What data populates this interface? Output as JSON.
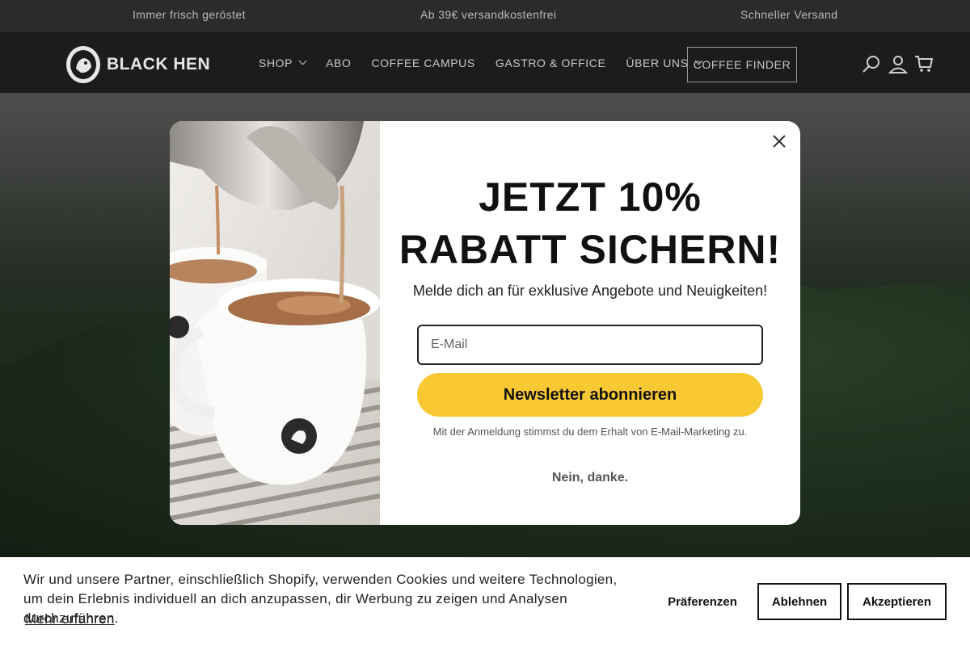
{
  "announcement": {
    "items": [
      "Immer frisch geröstet",
      "Ab 39€ versandkostenfrei",
      "Schneller Versand"
    ]
  },
  "header": {
    "logo_text": "BLACK HEN",
    "nav": [
      "SHOP",
      "ABO",
      "COFFEE CAMPUS",
      "GASTRO & OFFICE",
      "ÜBER UNS"
    ],
    "finder_label": "COFFEE FINDER",
    "icons": [
      "search-icon",
      "account-icon",
      "cart-icon"
    ]
  },
  "popup": {
    "headline_line1": "JETZT 10%",
    "headline_line2": "RABATT SICHERN!",
    "subtitle": "Melde dich an für exklusive Angebote und Neuigkeiten!",
    "email_placeholder": "E-Mail",
    "subscribe_label": "Newsletter abonnieren",
    "legal": "Mit der Anmeldung stimmst du dem Erhalt von E-Mail-Marketing zu.",
    "decline_label": "Nein, danke.",
    "accent_color": "#f9c934"
  },
  "cookie": {
    "text": "Wir und unsere Partner, einschließlich Shopify, verwenden Cookies und weitere Technologien, um dein Erlebnis individuell an dich anzupassen, dir Werbung zu zeigen und Analysen durchzuführen.",
    "link": "Mehr erfahren",
    "preferences": "Präferenzen",
    "decline": "Ablehnen",
    "accept": "Akzeptieren"
  }
}
